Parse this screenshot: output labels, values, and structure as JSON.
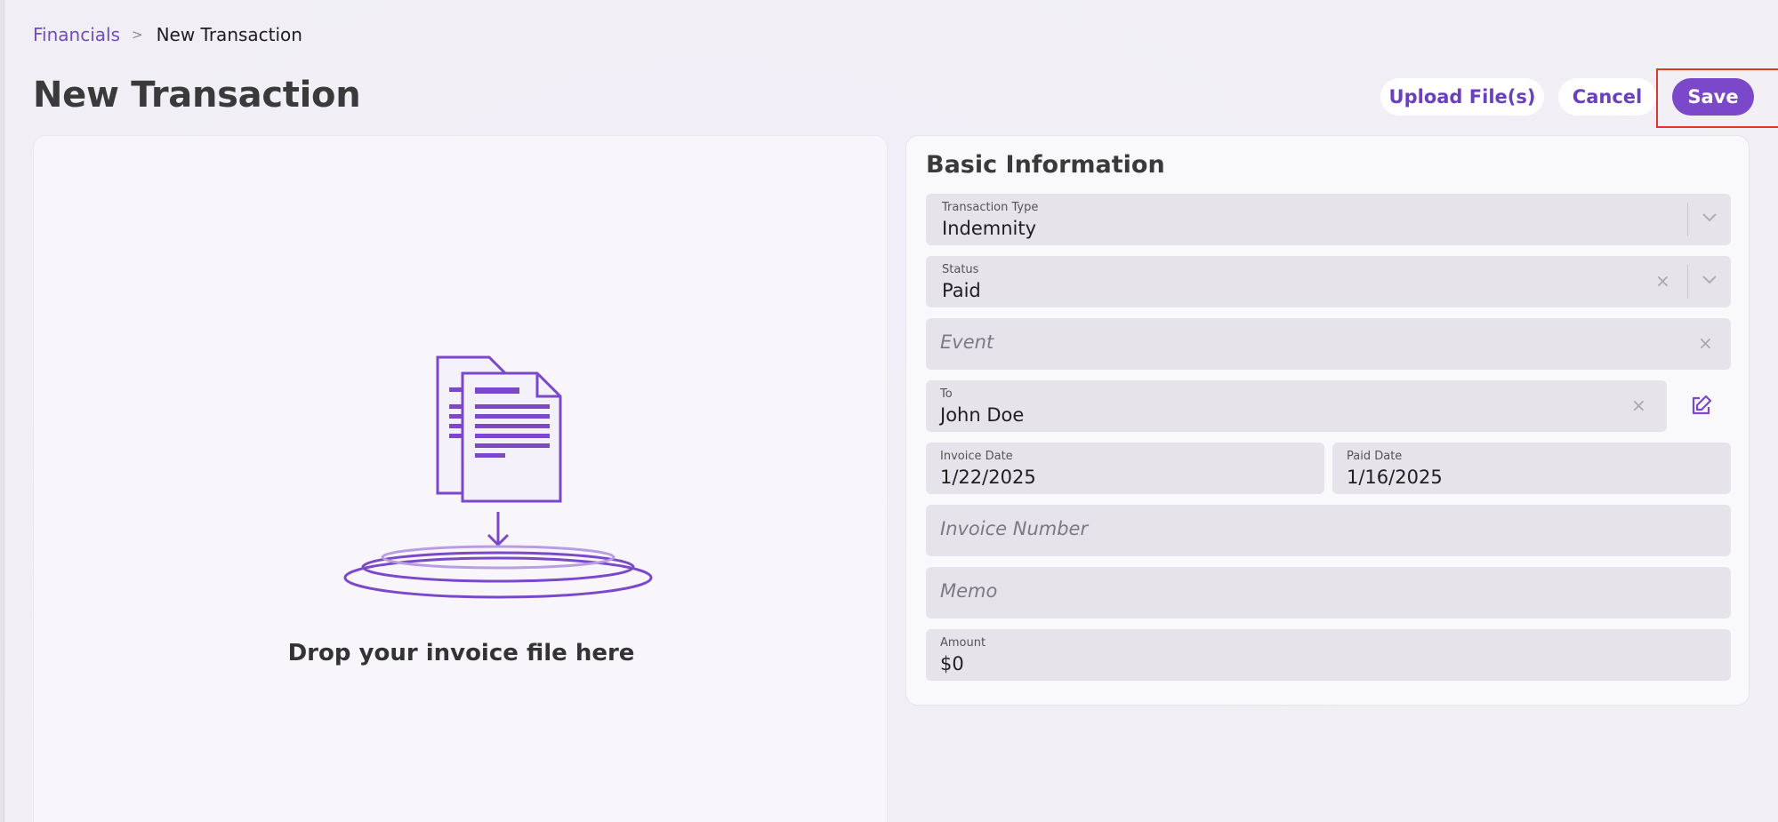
{
  "breadcrumb": {
    "parent": "Financials",
    "separator": ">",
    "current": "New Transaction"
  },
  "page": {
    "title": "New Transaction"
  },
  "actions": {
    "upload": "Upload File(s)",
    "cancel": "Cancel",
    "save": "Save"
  },
  "dropzone": {
    "text": "Drop your invoice file here"
  },
  "basic_info": {
    "title": "Basic Information",
    "transaction_type": {
      "label": "Transaction Type",
      "value": "Indemnity"
    },
    "status": {
      "label": "Status",
      "value": "Paid"
    },
    "event": {
      "placeholder": "Event"
    },
    "to": {
      "label": "To",
      "value": "John Doe"
    },
    "invoice_date": {
      "label": "Invoice Date",
      "value": "1/22/2025"
    },
    "paid_date": {
      "label": "Paid Date",
      "value": "1/16/2025"
    },
    "invoice_number": {
      "placeholder": "Invoice Number"
    },
    "memo": {
      "placeholder": "Memo"
    },
    "amount": {
      "label": "Amount",
      "value": "$0"
    }
  },
  "icons": {
    "clear": "×",
    "accent": "#7a48c9",
    "highlight": "#e0362b"
  }
}
